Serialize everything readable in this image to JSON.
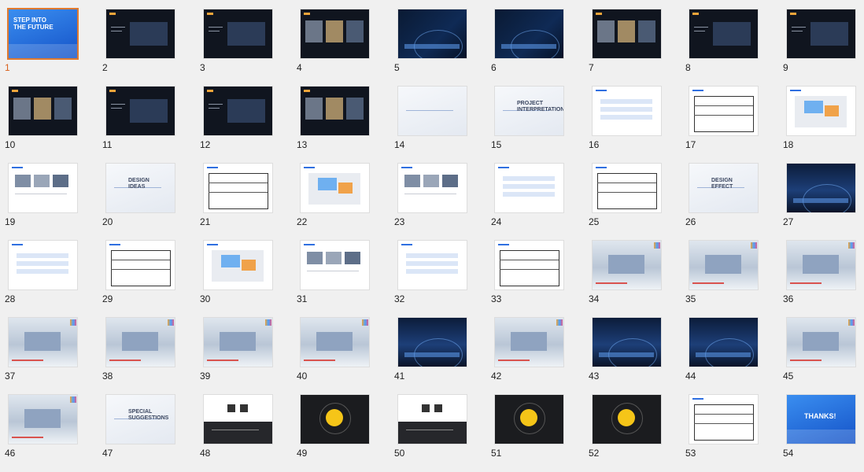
{
  "slides": [
    {
      "number": "1",
      "theme": "blue",
      "selected": true,
      "title_lines": [
        "STEP INTO",
        "THE FUTURE"
      ]
    },
    {
      "number": "2",
      "theme": "dark"
    },
    {
      "number": "3",
      "theme": "dark"
    },
    {
      "number": "4",
      "theme": "dark"
    },
    {
      "number": "5",
      "theme": "darkblue"
    },
    {
      "number": "6",
      "theme": "darkblue"
    },
    {
      "number": "7",
      "theme": "dark"
    },
    {
      "number": "8",
      "theme": "dark"
    },
    {
      "number": "9",
      "theme": "dark"
    },
    {
      "number": "10",
      "theme": "dark"
    },
    {
      "number": "11",
      "theme": "dark"
    },
    {
      "number": "12",
      "theme": "dark"
    },
    {
      "number": "13",
      "theme": "dark"
    },
    {
      "number": "14",
      "theme": "light"
    },
    {
      "number": "15",
      "theme": "light",
      "title_lines": [
        "PROJECT",
        "INTERPRETATION"
      ]
    },
    {
      "number": "16",
      "theme": "white"
    },
    {
      "number": "17",
      "theme": "white"
    },
    {
      "number": "18",
      "theme": "white"
    },
    {
      "number": "19",
      "theme": "white"
    },
    {
      "number": "20",
      "theme": "light",
      "title_lines": [
        "DESIGN",
        "IDEAS"
      ]
    },
    {
      "number": "21",
      "theme": "white"
    },
    {
      "number": "22",
      "theme": "white"
    },
    {
      "number": "23",
      "theme": "white"
    },
    {
      "number": "24",
      "theme": "white"
    },
    {
      "number": "25",
      "theme": "white"
    },
    {
      "number": "26",
      "theme": "light",
      "title_lines": [
        "DESIGN",
        "EFFECT"
      ]
    },
    {
      "number": "27",
      "theme": "photo-dark"
    },
    {
      "number": "28",
      "theme": "white"
    },
    {
      "number": "29",
      "theme": "white"
    },
    {
      "number": "30",
      "theme": "white"
    },
    {
      "number": "31",
      "theme": "white"
    },
    {
      "number": "32",
      "theme": "white"
    },
    {
      "number": "33",
      "theme": "white"
    },
    {
      "number": "34",
      "theme": "photo-light"
    },
    {
      "number": "35",
      "theme": "photo-light"
    },
    {
      "number": "36",
      "theme": "photo-light"
    },
    {
      "number": "37",
      "theme": "photo-light"
    },
    {
      "number": "38",
      "theme": "photo-light"
    },
    {
      "number": "39",
      "theme": "photo-light"
    },
    {
      "number": "40",
      "theme": "photo-light"
    },
    {
      "number": "41",
      "theme": "photo-dark"
    },
    {
      "number": "42",
      "theme": "photo-light"
    },
    {
      "number": "43",
      "theme": "photo-dark"
    },
    {
      "number": "44",
      "theme": "photo-dark"
    },
    {
      "number": "45",
      "theme": "photo-light"
    },
    {
      "number": "46",
      "theme": "photo-light"
    },
    {
      "number": "47",
      "theme": "light",
      "title_lines": [
        "SPECIAL",
        "SUGGESTIONS"
      ]
    },
    {
      "number": "48",
      "theme": "white-dark"
    },
    {
      "number": "49",
      "theme": "black"
    },
    {
      "number": "50",
      "theme": "white-dark"
    },
    {
      "number": "51",
      "theme": "black"
    },
    {
      "number": "52",
      "theme": "black"
    },
    {
      "number": "53",
      "theme": "white"
    },
    {
      "number": "54",
      "theme": "blue",
      "title_lines": [
        "THANKS!"
      ]
    }
  ],
  "colors": {
    "selection": "#e07a2f",
    "accent": "#2f6fe0"
  }
}
